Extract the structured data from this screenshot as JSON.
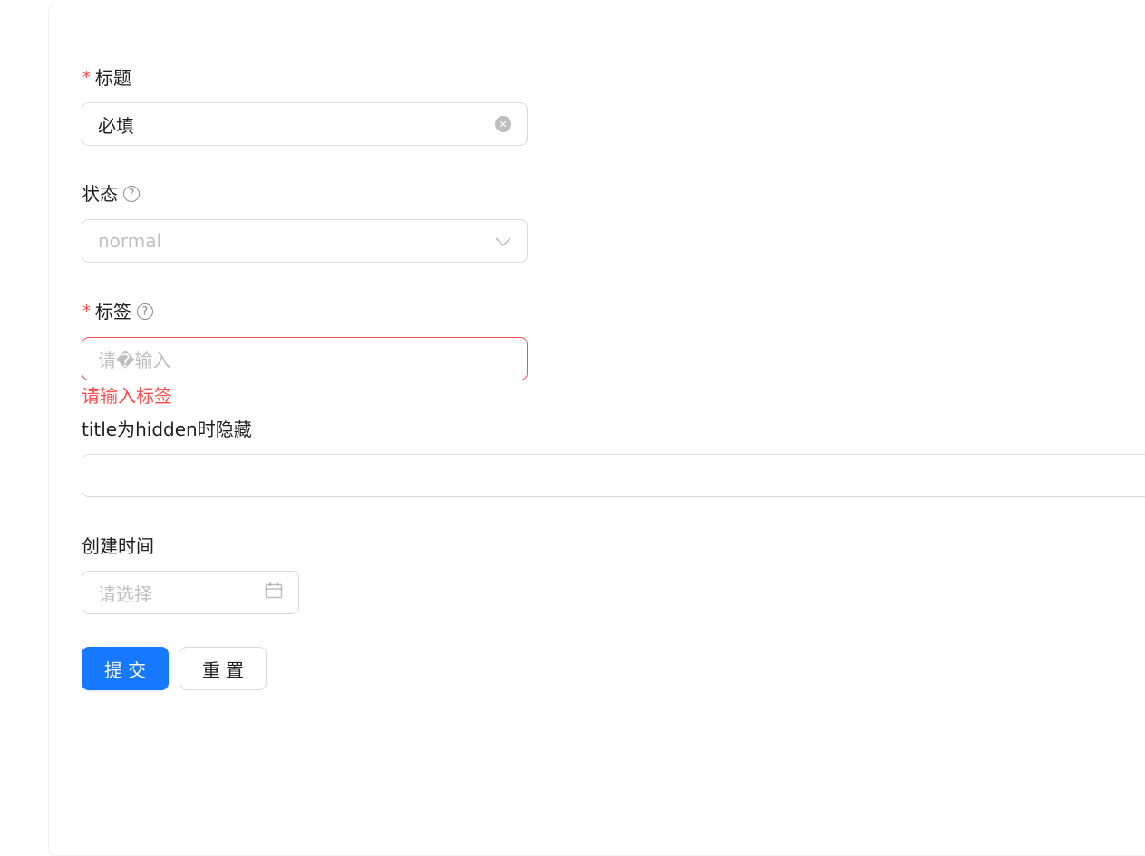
{
  "form": {
    "title_field": {
      "required_mark": "*",
      "label": "标题",
      "value": "必填",
      "clear_icon": "close-circle-icon"
    },
    "status_field": {
      "label": "状态",
      "help_icon": "question-circle-icon",
      "placeholder": "normal",
      "arrow_icon": "chevron-down-icon"
    },
    "tags_field": {
      "required_mark": "*",
      "label": "标签",
      "help_icon": "question-circle-icon",
      "placeholder": "请�输入",
      "error": "请输入标签"
    },
    "hidden_field": {
      "label": "title为hidden时隐藏",
      "value": ""
    },
    "created_time_field": {
      "label": "创建时间",
      "placeholder": "请选择",
      "calendar_icon": "calendar-icon"
    },
    "actions": {
      "submit_label": "提交",
      "reset_label": "重置"
    }
  },
  "colors": {
    "primary": "#1677ff",
    "error": "#ff4d4f",
    "border": "#d9d9d9"
  }
}
